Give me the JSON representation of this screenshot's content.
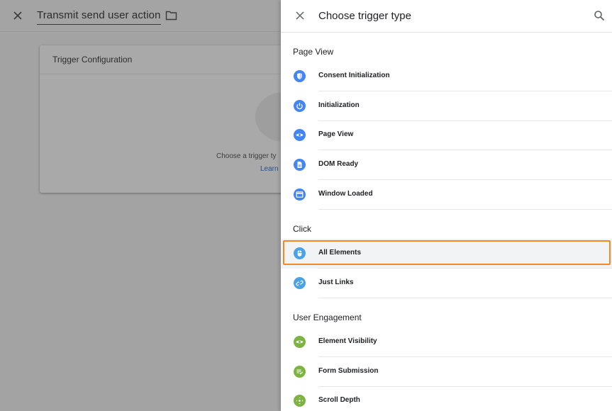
{
  "background": {
    "title": "Transmit send user action",
    "card": {
      "heading": "Trigger Configuration",
      "hint": "Choose a trigger ty",
      "link": "Learn"
    }
  },
  "panel": {
    "title": "Choose trigger type",
    "sections": [
      {
        "label": "Page View",
        "items": [
          {
            "label": "Consent Initialization",
            "icon": "shield-icon",
            "color": "#4285f4"
          },
          {
            "label": "Initialization",
            "icon": "power-icon",
            "color": "#4285f4"
          },
          {
            "label": "Page View",
            "icon": "eye-icon",
            "color": "#4285f4"
          },
          {
            "label": "DOM Ready",
            "icon": "document-icon",
            "color": "#4285f4"
          },
          {
            "label": "Window Loaded",
            "icon": "window-icon",
            "color": "#4285f4"
          }
        ]
      },
      {
        "label": "Click",
        "items": [
          {
            "label": "All Elements",
            "icon": "mouse-icon",
            "color": "#4ba2e4",
            "selected": true
          },
          {
            "label": "Just Links",
            "icon": "link-icon",
            "color": "#4ba2e4"
          }
        ]
      },
      {
        "label": "User Engagement",
        "items": [
          {
            "label": "Element Visibility",
            "icon": "eye-icon",
            "color": "#7cb342"
          },
          {
            "label": "Form Submission",
            "icon": "form-icon",
            "color": "#7cb342"
          },
          {
            "label": "Scroll Depth",
            "icon": "move-icon",
            "color": "#7cb342"
          }
        ]
      }
    ]
  }
}
